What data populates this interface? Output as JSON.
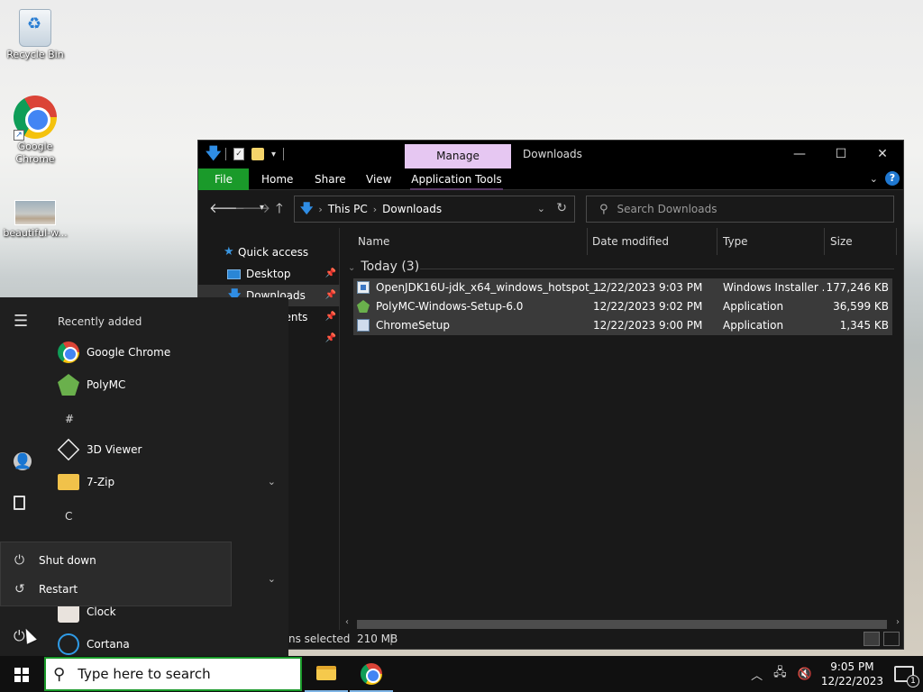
{
  "desktop": {
    "icons": [
      {
        "label": "Recycle Bin",
        "icon": "recycle-bin-icon"
      },
      {
        "label": "Google Chrome",
        "icon": "chrome-icon"
      },
      {
        "label": "beautiful-w...",
        "icon": "image-thumbnail-icon"
      }
    ]
  },
  "explorer": {
    "title": "Downloads",
    "context_tab": "Manage",
    "ribbon_tabs": [
      "File",
      "Home",
      "Share",
      "View",
      "Application Tools"
    ],
    "address": {
      "root": "This PC",
      "current": "Downloads"
    },
    "search_placeholder": "Search Downloads",
    "nav": {
      "quick_access": "Quick access",
      "items": [
        {
          "label": "Desktop",
          "icon": "desktop-icon"
        },
        {
          "label": "Downloads",
          "icon": "downloads-icon"
        },
        {
          "label": "Documents",
          "icon": "documents-icon"
        }
      ]
    },
    "columns": [
      "Name",
      "Date modified",
      "Type",
      "Size"
    ],
    "group": "Today (3)",
    "files": [
      {
        "name": "OpenJDK16U-jdk_x64_windows_hotspot_...",
        "date": "12/22/2023 9:03 PM",
        "type": "Windows Installer ...",
        "size": "177,246 KB",
        "icon": "msi-installer-icon"
      },
      {
        "name": "PolyMC-Windows-Setup-6.0",
        "date": "12/22/2023 9:02 PM",
        "type": "Application",
        "size": "36,599 KB",
        "icon": "polymc-icon"
      },
      {
        "name": "ChromeSetup",
        "date": "12/22/2023 9:00 PM",
        "type": "Application",
        "size": "1,345 KB",
        "icon": "setup-icon"
      }
    ],
    "status": "ns selected  210 MB"
  },
  "start_menu": {
    "recently_added_header": "Recently added",
    "recent_apps": [
      {
        "label": "Google Chrome",
        "icon": "chrome-icon"
      },
      {
        "label": "PolyMC",
        "icon": "polymc-icon"
      }
    ],
    "section_hash": "#",
    "apps_hash": [
      {
        "label": "3D Viewer",
        "icon": "cube-icon"
      },
      {
        "label": "7-Zip",
        "icon": "folder-icon"
      }
    ],
    "section_c": "C",
    "apps_c": [
      {
        "label": "Clock",
        "icon": "clock-icon"
      },
      {
        "label": "Cortana",
        "icon": "cortana-icon"
      }
    ],
    "power_options": [
      "Shut down",
      "Restart"
    ]
  },
  "taskbar": {
    "search_placeholder": "Type here to search",
    "pinned": [
      {
        "name": "File Explorer",
        "icon": "file-explorer-icon"
      },
      {
        "name": "Google Chrome",
        "icon": "chrome-icon"
      }
    ],
    "time": "9:05 PM",
    "date": "12/22/2023",
    "notification_count": "1"
  }
}
